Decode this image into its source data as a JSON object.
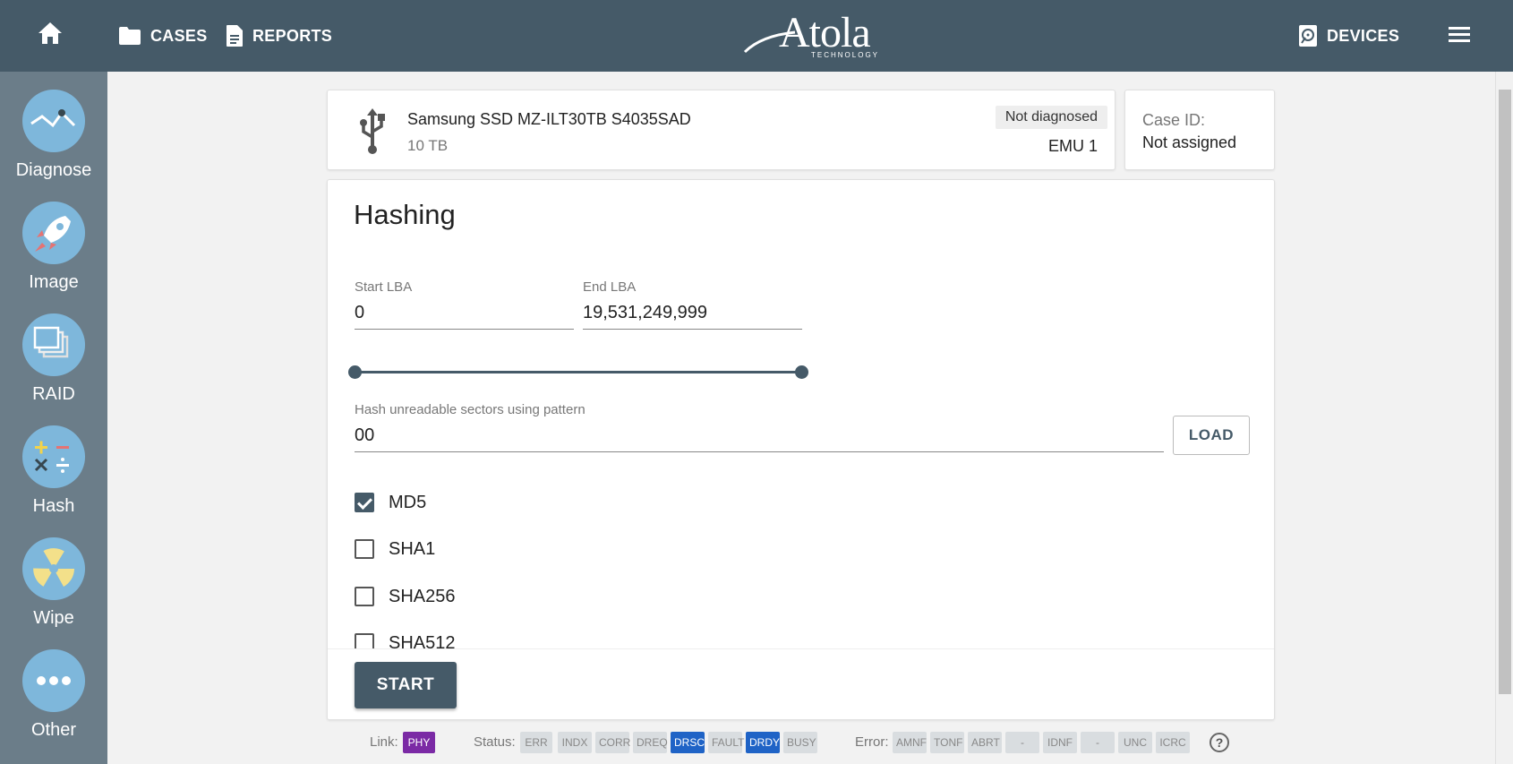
{
  "topbar": {
    "cases_label": "CASES",
    "reports_label": "REPORTS",
    "devices_label": "DEVICES",
    "logo_text": "Atola",
    "logo_sub": "TECHNOLOGY"
  },
  "sidebar": {
    "items": [
      {
        "label": "Diagnose",
        "icon": "diagnose-icon"
      },
      {
        "label": "Image",
        "icon": "rocket-icon"
      },
      {
        "label": "RAID",
        "icon": "raid-icon"
      },
      {
        "label": "Hash",
        "icon": "calculator-icon"
      },
      {
        "label": "Wipe",
        "icon": "radiation-icon"
      },
      {
        "label": "Other",
        "icon": "more-icon"
      }
    ]
  },
  "device": {
    "name": "Samsung SSD MZ-ILT30TB S4035SAD",
    "size": "10 TB",
    "status": "Not diagnosed",
    "emu": "EMU 1"
  },
  "case": {
    "label": "Case ID:",
    "value": "Not assigned"
  },
  "hashing": {
    "title": "Hashing",
    "start_lba_label": "Start LBA",
    "start_lba_value": "0",
    "end_lba_label": "End LBA",
    "end_lba_value": "19,531,249,999",
    "pattern_label": "Hash unreadable sectors using pattern",
    "pattern_value": "00",
    "load_label": "LOAD",
    "algorithms": [
      {
        "label": "MD5",
        "checked": true
      },
      {
        "label": "SHA1",
        "checked": false
      },
      {
        "label": "SHA256",
        "checked": false
      },
      {
        "label": "SHA512",
        "checked": false
      }
    ],
    "start_label": "START"
  },
  "status_bar": {
    "link_label": "Link:",
    "link_chip": "PHY",
    "status_label": "Status:",
    "status_chips": [
      "ERR",
      "INDX",
      "CORR",
      "DREQ",
      "DRSC",
      "FAULT",
      "DRDY",
      "BUSY"
    ],
    "status_active": [
      "DRSC",
      "DRDY"
    ],
    "error_label": "Error:",
    "error_chips": [
      "AMNF",
      "TONF",
      "ABRT",
      "-",
      "IDNF",
      "-",
      "UNC",
      "ICRC"
    ],
    "help": "?"
  },
  "colors": {
    "topbar": "#455a68",
    "sidebar": "#6b7d89",
    "accent": "#455a68",
    "chip_active": "#1f63c6",
    "link_chip": "#7b2aa5"
  }
}
